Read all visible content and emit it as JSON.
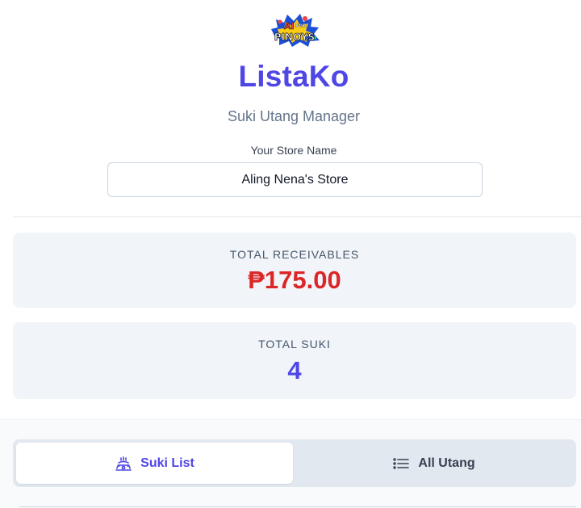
{
  "header": {
    "logo_text": {
      "line1": "AI FOR",
      "line2": "PINOYS"
    },
    "title": "ListaKo",
    "subtitle": "Suki Utang Manager"
  },
  "store": {
    "label": "Your Store Name",
    "value": "Aling Nena's Store"
  },
  "stats": {
    "receivables": {
      "label": "TOTAL RECEIVABLES",
      "value": "₱175.00"
    },
    "suki": {
      "label": "TOTAL SUKI",
      "value": "4"
    }
  },
  "tabs": [
    {
      "label": "Suki List",
      "icon": "users-icon",
      "active": true
    },
    {
      "label": "All Utang",
      "icon": "list-icon",
      "active": false
    }
  ],
  "colors": {
    "accent": "#4f46e5",
    "receivable": "#dc2626",
    "card_bg": "#f1f5f9"
  }
}
